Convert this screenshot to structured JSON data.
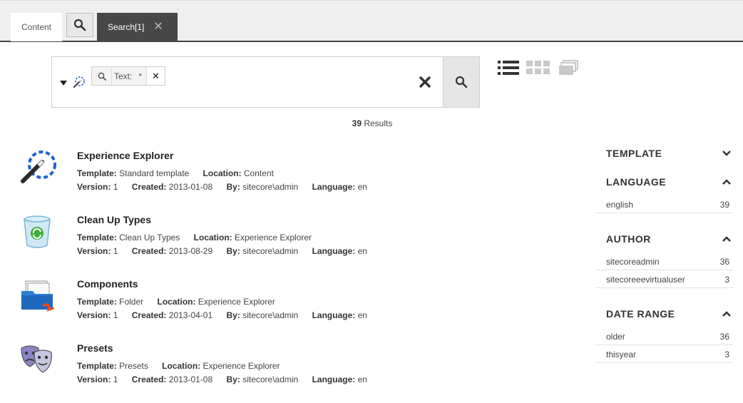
{
  "tabs": {
    "content_label": "Content",
    "active_label": "Search[1]",
    "close_glyph": "✕"
  },
  "search": {
    "chip_label": "Text:",
    "chip_value": "*",
    "chip_close": "✕"
  },
  "results": {
    "count": "39",
    "count_suffix": " Results",
    "items": [
      {
        "title": "Experience Explorer",
        "icon": "magic-wand-icon",
        "template_label": "Template:",
        "template": "Standard template",
        "location_label": "Location:",
        "location": "Content",
        "version_label": "Version:",
        "version": "1",
        "created_label": "Created:",
        "created": "2013-01-08",
        "by_label": "By:",
        "by": "sitecore\\admin",
        "language_label": "Language:",
        "language": "en"
      },
      {
        "title": "Clean Up Types",
        "icon": "recycle-bin-icon",
        "template_label": "Template:",
        "template": "Clean Up Types",
        "location_label": "Location:",
        "location": "Experience Explorer",
        "version_label": "Version:",
        "version": "1",
        "created_label": "Created:",
        "created": "2013-08-29",
        "by_label": "By:",
        "by": "sitecore\\admin",
        "language_label": "Language:",
        "language": "en"
      },
      {
        "title": "Components",
        "icon": "folder-icon",
        "template_label": "Template:",
        "template": "Folder",
        "location_label": "Location:",
        "location": "Experience Explorer",
        "version_label": "Version:",
        "version": "1",
        "created_label": "Created:",
        "created": "2013-04-01",
        "by_label": "By:",
        "by": "sitecore\\admin",
        "language_label": "Language:",
        "language": "en"
      },
      {
        "title": "Presets",
        "icon": "theater-masks-icon",
        "template_label": "Template:",
        "template": "Presets",
        "location_label": "Location:",
        "location": "Experience Explorer",
        "version_label": "Version:",
        "version": "1",
        "created_label": "Created:",
        "created": "2013-01-08",
        "by_label": "By:",
        "by": "sitecore\\admin",
        "language_label": "Language:",
        "language": "en"
      }
    ]
  },
  "facets": {
    "template": {
      "title": "TEMPLATE",
      "state": "collapsed"
    },
    "language": {
      "title": "LANGUAGE",
      "state": "expanded",
      "items": [
        {
          "label": "english",
          "count": "39"
        }
      ]
    },
    "author": {
      "title": "AUTHOR",
      "state": "expanded",
      "items": [
        {
          "label": "sitecoreadmin",
          "count": "36"
        },
        {
          "label": "sitecoreeevirtualuser",
          "count": "3"
        }
      ]
    },
    "date_range": {
      "title": "DATE RANGE",
      "state": "expanded",
      "items": [
        {
          "label": "older",
          "count": "36"
        },
        {
          "label": "thisyear",
          "count": "3"
        }
      ]
    }
  },
  "colors": {
    "tab_active_bg": "#474747",
    "accent_blue": "#1f6fd0"
  }
}
